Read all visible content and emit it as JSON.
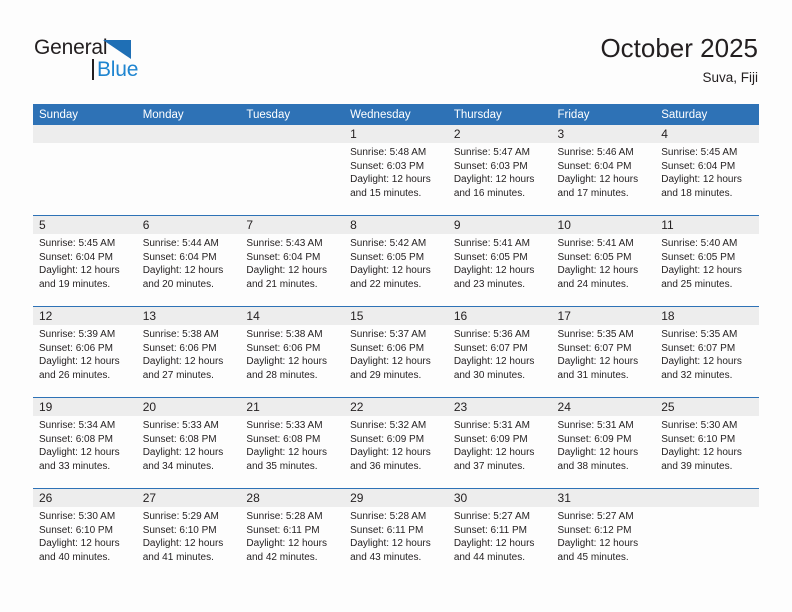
{
  "logo": {
    "top_text": "General",
    "bottom_text": "Blue",
    "triangle_icon": "blue-triangle-icon",
    "top_color": "#231f20",
    "bottom_color": "#1f85d0"
  },
  "header": {
    "title": "October 2025",
    "location": "Suva, Fiji"
  },
  "colors": {
    "header_blue": "#2e72b6",
    "daynum_band": "#ededed",
    "text": "#231f20",
    "page_background": "#fdfdfd"
  },
  "calendar": {
    "weekday_headers": [
      "Sunday",
      "Monday",
      "Tuesday",
      "Wednesday",
      "Thursday",
      "Friday",
      "Saturday"
    ],
    "labels": {
      "sunrise": "Sunrise:",
      "sunset": "Sunset:",
      "daylight": "Daylight:"
    },
    "weeks": [
      [
        {
          "day": ""
        },
        {
          "day": ""
        },
        {
          "day": ""
        },
        {
          "day": "1",
          "sunrise": "Sunrise: 5:48 AM",
          "sunset": "Sunset: 6:03 PM",
          "daylight_1": "Daylight: 12 hours",
          "daylight_2": "and 15 minutes."
        },
        {
          "day": "2",
          "sunrise": "Sunrise: 5:47 AM",
          "sunset": "Sunset: 6:03 PM",
          "daylight_1": "Daylight: 12 hours",
          "daylight_2": "and 16 minutes."
        },
        {
          "day": "3",
          "sunrise": "Sunrise: 5:46 AM",
          "sunset": "Sunset: 6:04 PM",
          "daylight_1": "Daylight: 12 hours",
          "daylight_2": "and 17 minutes."
        },
        {
          "day": "4",
          "sunrise": "Sunrise: 5:45 AM",
          "sunset": "Sunset: 6:04 PM",
          "daylight_1": "Daylight: 12 hours",
          "daylight_2": "and 18 minutes."
        }
      ],
      [
        {
          "day": "5",
          "sunrise": "Sunrise: 5:45 AM",
          "sunset": "Sunset: 6:04 PM",
          "daylight_1": "Daylight: 12 hours",
          "daylight_2": "and 19 minutes."
        },
        {
          "day": "6",
          "sunrise": "Sunrise: 5:44 AM",
          "sunset": "Sunset: 6:04 PM",
          "daylight_1": "Daylight: 12 hours",
          "daylight_2": "and 20 minutes."
        },
        {
          "day": "7",
          "sunrise": "Sunrise: 5:43 AM",
          "sunset": "Sunset: 6:04 PM",
          "daylight_1": "Daylight: 12 hours",
          "daylight_2": "and 21 minutes."
        },
        {
          "day": "8",
          "sunrise": "Sunrise: 5:42 AM",
          "sunset": "Sunset: 6:05 PM",
          "daylight_1": "Daylight: 12 hours",
          "daylight_2": "and 22 minutes."
        },
        {
          "day": "9",
          "sunrise": "Sunrise: 5:41 AM",
          "sunset": "Sunset: 6:05 PM",
          "daylight_1": "Daylight: 12 hours",
          "daylight_2": "and 23 minutes."
        },
        {
          "day": "10",
          "sunrise": "Sunrise: 5:41 AM",
          "sunset": "Sunset: 6:05 PM",
          "daylight_1": "Daylight: 12 hours",
          "daylight_2": "and 24 minutes."
        },
        {
          "day": "11",
          "sunrise": "Sunrise: 5:40 AM",
          "sunset": "Sunset: 6:05 PM",
          "daylight_1": "Daylight: 12 hours",
          "daylight_2": "and 25 minutes."
        }
      ],
      [
        {
          "day": "12",
          "sunrise": "Sunrise: 5:39 AM",
          "sunset": "Sunset: 6:06 PM",
          "daylight_1": "Daylight: 12 hours",
          "daylight_2": "and 26 minutes."
        },
        {
          "day": "13",
          "sunrise": "Sunrise: 5:38 AM",
          "sunset": "Sunset: 6:06 PM",
          "daylight_1": "Daylight: 12 hours",
          "daylight_2": "and 27 minutes."
        },
        {
          "day": "14",
          "sunrise": "Sunrise: 5:38 AM",
          "sunset": "Sunset: 6:06 PM",
          "daylight_1": "Daylight: 12 hours",
          "daylight_2": "and 28 minutes."
        },
        {
          "day": "15",
          "sunrise": "Sunrise: 5:37 AM",
          "sunset": "Sunset: 6:06 PM",
          "daylight_1": "Daylight: 12 hours",
          "daylight_2": "and 29 minutes."
        },
        {
          "day": "16",
          "sunrise": "Sunrise: 5:36 AM",
          "sunset": "Sunset: 6:07 PM",
          "daylight_1": "Daylight: 12 hours",
          "daylight_2": "and 30 minutes."
        },
        {
          "day": "17",
          "sunrise": "Sunrise: 5:35 AM",
          "sunset": "Sunset: 6:07 PM",
          "daylight_1": "Daylight: 12 hours",
          "daylight_2": "and 31 minutes."
        },
        {
          "day": "18",
          "sunrise": "Sunrise: 5:35 AM",
          "sunset": "Sunset: 6:07 PM",
          "daylight_1": "Daylight: 12 hours",
          "daylight_2": "and 32 minutes."
        }
      ],
      [
        {
          "day": "19",
          "sunrise": "Sunrise: 5:34 AM",
          "sunset": "Sunset: 6:08 PM",
          "daylight_1": "Daylight: 12 hours",
          "daylight_2": "and 33 minutes."
        },
        {
          "day": "20",
          "sunrise": "Sunrise: 5:33 AM",
          "sunset": "Sunset: 6:08 PM",
          "daylight_1": "Daylight: 12 hours",
          "daylight_2": "and 34 minutes."
        },
        {
          "day": "21",
          "sunrise": "Sunrise: 5:33 AM",
          "sunset": "Sunset: 6:08 PM",
          "daylight_1": "Daylight: 12 hours",
          "daylight_2": "and 35 minutes."
        },
        {
          "day": "22",
          "sunrise": "Sunrise: 5:32 AM",
          "sunset": "Sunset: 6:09 PM",
          "daylight_1": "Daylight: 12 hours",
          "daylight_2": "and 36 minutes."
        },
        {
          "day": "23",
          "sunrise": "Sunrise: 5:31 AM",
          "sunset": "Sunset: 6:09 PM",
          "daylight_1": "Daylight: 12 hours",
          "daylight_2": "and 37 minutes."
        },
        {
          "day": "24",
          "sunrise": "Sunrise: 5:31 AM",
          "sunset": "Sunset: 6:09 PM",
          "daylight_1": "Daylight: 12 hours",
          "daylight_2": "and 38 minutes."
        },
        {
          "day": "25",
          "sunrise": "Sunrise: 5:30 AM",
          "sunset": "Sunset: 6:10 PM",
          "daylight_1": "Daylight: 12 hours",
          "daylight_2": "and 39 minutes."
        }
      ],
      [
        {
          "day": "26",
          "sunrise": "Sunrise: 5:30 AM",
          "sunset": "Sunset: 6:10 PM",
          "daylight_1": "Daylight: 12 hours",
          "daylight_2": "and 40 minutes."
        },
        {
          "day": "27",
          "sunrise": "Sunrise: 5:29 AM",
          "sunset": "Sunset: 6:10 PM",
          "daylight_1": "Daylight: 12 hours",
          "daylight_2": "and 41 minutes."
        },
        {
          "day": "28",
          "sunrise": "Sunrise: 5:28 AM",
          "sunset": "Sunset: 6:11 PM",
          "daylight_1": "Daylight: 12 hours",
          "daylight_2": "and 42 minutes."
        },
        {
          "day": "29",
          "sunrise": "Sunrise: 5:28 AM",
          "sunset": "Sunset: 6:11 PM",
          "daylight_1": "Daylight: 12 hours",
          "daylight_2": "and 43 minutes."
        },
        {
          "day": "30",
          "sunrise": "Sunrise: 5:27 AM",
          "sunset": "Sunset: 6:11 PM",
          "daylight_1": "Daylight: 12 hours",
          "daylight_2": "and 44 minutes."
        },
        {
          "day": "31",
          "sunrise": "Sunrise: 5:27 AM",
          "sunset": "Sunset: 6:12 PM",
          "daylight_1": "Daylight: 12 hours",
          "daylight_2": "and 45 minutes."
        },
        {
          "day": ""
        }
      ]
    ]
  }
}
